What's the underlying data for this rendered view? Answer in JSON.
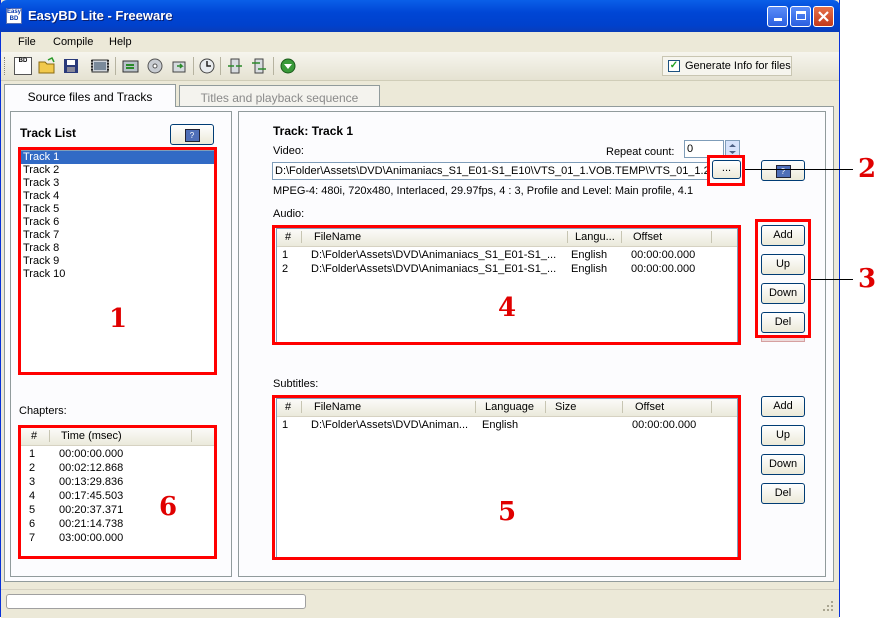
{
  "window": {
    "title": "EasyBD Lite - Freeware",
    "icon_text": "Easy BD"
  },
  "menu": [
    "File",
    "Compile",
    "Help"
  ],
  "toolbar": {
    "icons": [
      "new-disc-icon",
      "open-folder-icon",
      "save-icon",
      "add-track-icon",
      "compile-icon",
      "disc-icon",
      "import-icon",
      "chapters-icon",
      "split-icon",
      "merge-icon",
      "burn-icon"
    ],
    "generate_info_label": "Generate Info for files",
    "generate_info_checked": true
  },
  "tabs": [
    "Source files and Tracks",
    "Titles and playback sequence"
  ],
  "left": {
    "track_list_title": "Track List",
    "tracks": [
      "Track 1",
      "Track 2",
      "Track 3",
      "Track 4",
      "Track 5",
      "Track 6",
      "Track 7",
      "Track 8",
      "Track 9",
      "Track 10"
    ],
    "chapters_label": "Chapters:",
    "chapter_headers": [
      "#",
      "Time (msec)"
    ],
    "chapters": [
      {
        "n": "1",
        "t": "00:00:00.000"
      },
      {
        "n": "2",
        "t": "00:02:12.868"
      },
      {
        "n": "3",
        "t": "00:13:29.836"
      },
      {
        "n": "4",
        "t": "00:17:45.503"
      },
      {
        "n": "5",
        "t": "00:20:37.371"
      },
      {
        "n": "6",
        "t": "00:21:14.738"
      },
      {
        "n": "7",
        "t": "03:00:00.000"
      }
    ]
  },
  "right": {
    "track_title": "Track: Track 1",
    "video_label": "Video:",
    "repeat_label": "Repeat count:",
    "repeat_value": "0",
    "video_path": "D:\\Folder\\Assets\\DVD\\Animaniacs_S1_E01-S1_E10\\VTS_01_1.VOB.TEMP\\VTS_01_1.2",
    "browse_label": "...",
    "video_info": "MPEG-4: 480i,  720x480,  Interlaced,  29.97fps,  4 : 3,  Profile and Level: Main profile,  4.1",
    "audio_label": "Audio:",
    "audio_headers": [
      "#",
      "FileName",
      "Langu...",
      "Offset"
    ],
    "audio_rows": [
      {
        "n": "1",
        "file": "D:\\Folder\\Assets\\DVD\\Animaniacs_S1_E01-S1_...",
        "lang": "English",
        "offset": "00:00:00.000"
      },
      {
        "n": "2",
        "file": "D:\\Folder\\Assets\\DVD\\Animaniacs_S1_E01-S1_...",
        "lang": "English",
        "offset": "00:00:00.000"
      }
    ],
    "subtitles_label": "Subtitles:",
    "sub_headers": [
      "#",
      "FileName",
      "Language",
      "Size",
      "Offset"
    ],
    "sub_rows": [
      {
        "n": "1",
        "file": "D:\\Folder\\Assets\\DVD\\Animan...",
        "lang": "English",
        "size": "",
        "offset": "00:00:00.000"
      }
    ],
    "buttons": {
      "add": "Add",
      "up": "Up",
      "down": "Down",
      "del": "Del"
    }
  },
  "callouts": [
    "1",
    "2",
    "3",
    "4",
    "5",
    "6"
  ],
  "colors": {
    "callout_red": "#ff0000",
    "selection": "#316ac5",
    "titlebar": "#0046d5"
  }
}
